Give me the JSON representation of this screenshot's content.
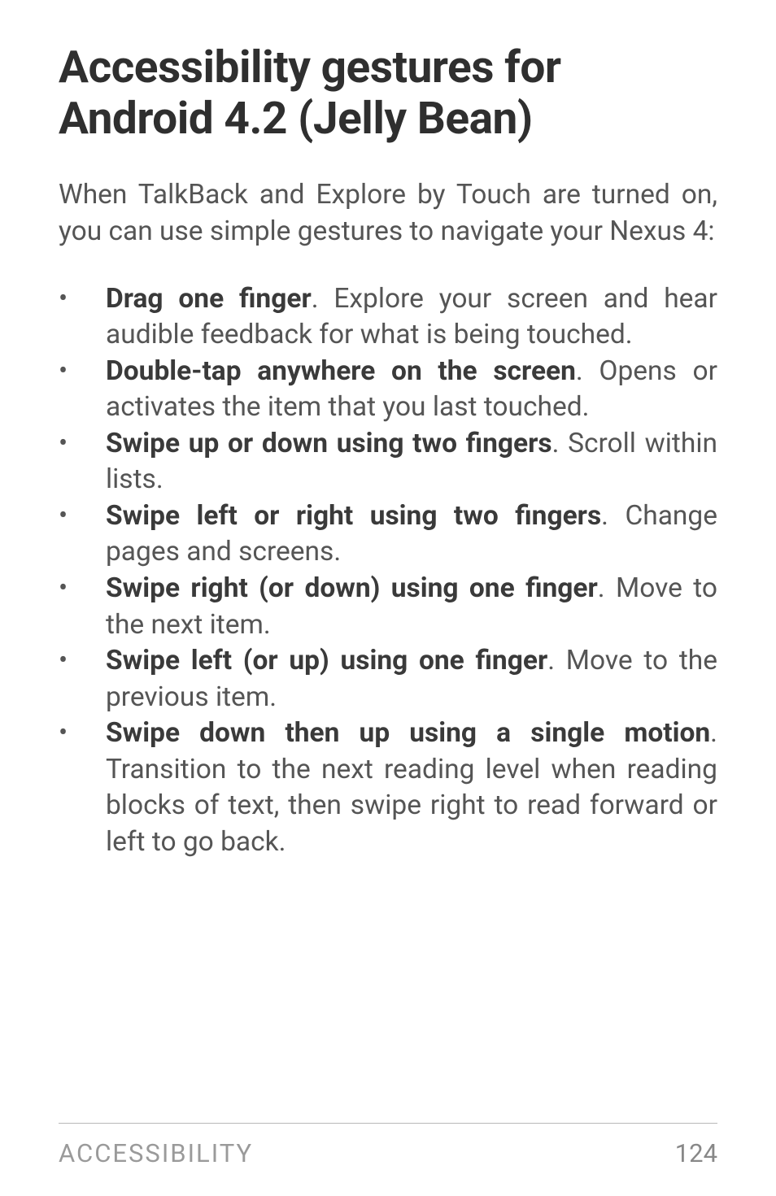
{
  "heading": "Accessibility gestures for Android 4.2 (Jelly Bean)",
  "intro": "When TalkBack and Explore by Touch are turned on, you can use simple gestures to navigate your Nexus 4:",
  "bullets": [
    {
      "bold": "Drag one finger",
      "rest": ". Explore your screen and hear audible feedback for what is being touched."
    },
    {
      "bold": "Double-tap anywhere on the screen",
      "rest": ". Opens or activates the item that you last touched."
    },
    {
      "bold": "Swipe up or down using two fingers",
      "rest": ". Scroll within lists."
    },
    {
      "bold": "Swipe left or right using two fingers",
      "rest": ". Change pages and screens."
    },
    {
      "bold": "Swipe right (or down) using one finger",
      "rest": ". Move to the next item."
    },
    {
      "bold": "Swipe left (or up) using one finger",
      "rest": ". Move to the previous item."
    },
    {
      "bold": "Swipe down then up using a single motion",
      "rest": ". Transition to the next reading level when reading blocks of text, then swipe right to read forward or left to go back."
    }
  ],
  "footer": {
    "section": "ACCESSIBILITY",
    "page": "124"
  }
}
